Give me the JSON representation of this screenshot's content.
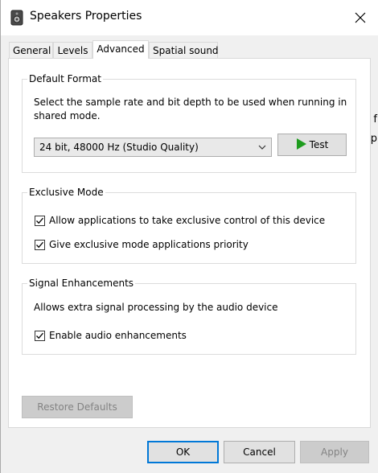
{
  "window": {
    "title": "Speakers Properties",
    "icon": "speaker-icon",
    "close_icon": "close-icon"
  },
  "tabs": [
    {
      "label": "General",
      "active": false
    },
    {
      "label": "Levels",
      "active": false
    },
    {
      "label": "Advanced",
      "active": true
    },
    {
      "label": "Spatial sound",
      "active": false
    }
  ],
  "default_format": {
    "group_label": "Default Format",
    "description_line1": "Select the sample rate and bit depth to be used when running in",
    "description_line2": "shared mode.",
    "selected_format": "24 bit, 48000 Hz (Studio Quality)",
    "test_label": "Test",
    "test_icon": "play-icon",
    "test_icon_color": "#1e9c1e"
  },
  "exclusive_mode": {
    "group_label": "Exclusive Mode",
    "options": [
      {
        "label": "Allow applications to take exclusive control of this device",
        "checked": true
      },
      {
        "label": "Give exclusive mode applications priority",
        "checked": true
      }
    ]
  },
  "signal_enhancements": {
    "group_label": "Signal Enhancements",
    "description": "Allows extra signal processing by the audio device",
    "options": [
      {
        "label": "Enable audio enhancements",
        "checked": true
      }
    ]
  },
  "restore_defaults_label": "Restore Defaults",
  "footer": {
    "ok_label": "OK",
    "cancel_label": "Cancel",
    "apply_label": "Apply"
  },
  "colors": {
    "accent": "#0078d7",
    "disabled_text": "#838383"
  }
}
